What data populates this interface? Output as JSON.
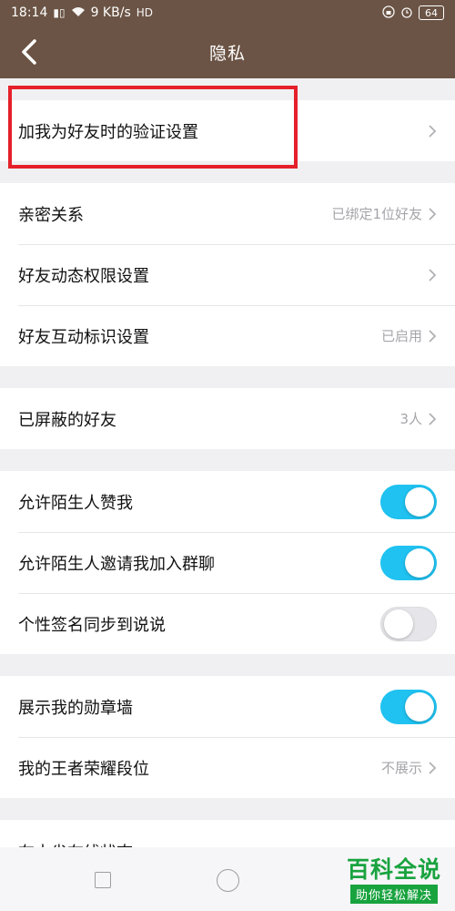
{
  "status_bar": {
    "time": "18:14",
    "speed": "9 KB/s",
    "hd": "HD",
    "battery": "64"
  },
  "header": {
    "title": "隐私"
  },
  "groups": {
    "verify": {
      "label": "加我为好友时的验证设置"
    },
    "relations": [
      {
        "label": "亲密关系",
        "value": "已绑定1位好友"
      },
      {
        "label": "好友动态权限设置",
        "value": ""
      },
      {
        "label": "好友互动标识设置",
        "value": "已启用"
      }
    ],
    "blocked": {
      "label": "已屏蔽的好友",
      "value": "3人"
    },
    "toggles": [
      {
        "label": "允许陌生人赞我",
        "on": true
      },
      {
        "label": "允许陌生人邀请我加入群聊",
        "on": true
      },
      {
        "label": "个性签名同步到说说",
        "on": false
      }
    ],
    "game": [
      {
        "label": "展示我的勋章墙",
        "on": true
      },
      {
        "label": "我的王者荣耀段位",
        "value": "不展示"
      }
    ]
  },
  "partial_row": {
    "label": "在本省在线状态"
  },
  "watermark": {
    "big": "百科全说",
    "small": "助你轻松解决"
  },
  "colors": {
    "header_bg": "#6b5445",
    "toggle_on": "#1fc2f0",
    "highlight": "#e5202a",
    "watermark": "#19a33f"
  }
}
